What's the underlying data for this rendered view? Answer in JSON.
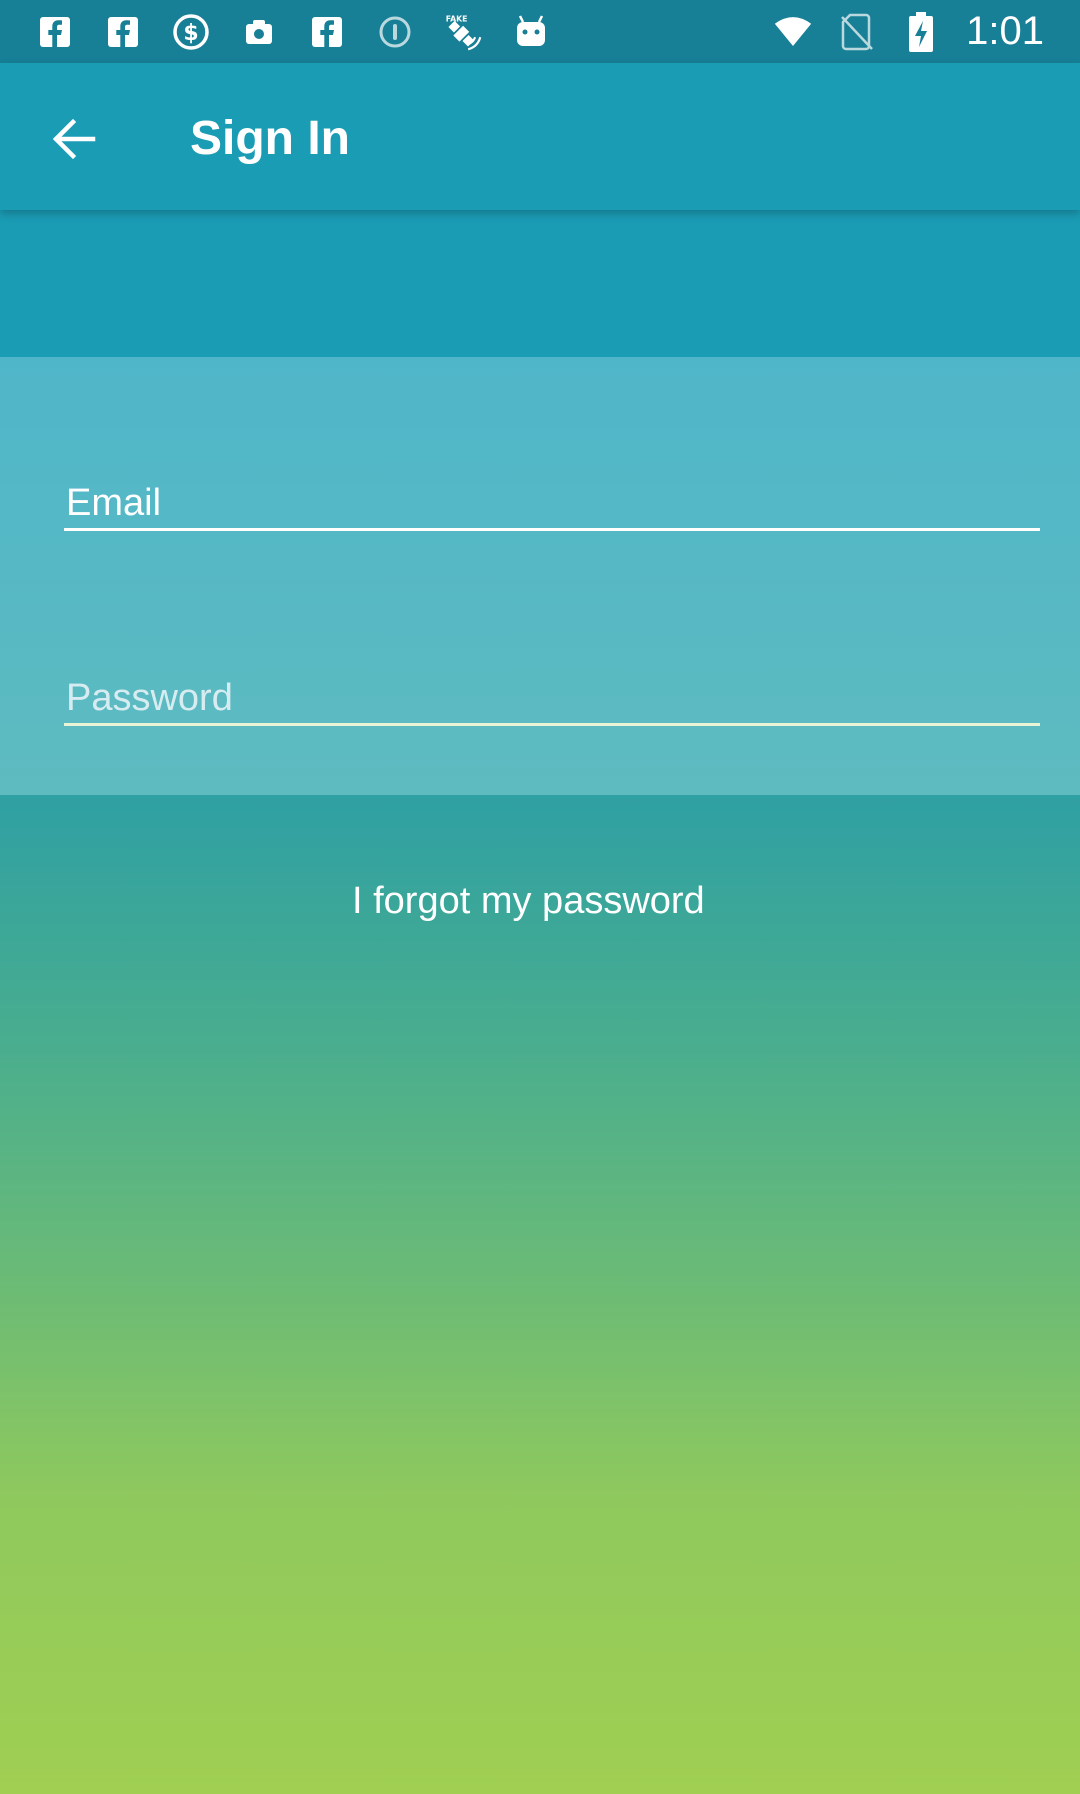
{
  "status_bar": {
    "time": "1:01",
    "left_icons": [
      "facebook-icon",
      "facebook-icon",
      "dollar-circle-icon",
      "camera-icon",
      "facebook-icon",
      "info-circle-icon",
      "fake-gps-satellite-icon",
      "android-robot-icon"
    ],
    "right_icons": [
      "wifi-icon",
      "no-sim-icon",
      "battery-charging-icon"
    ]
  },
  "toolbar": {
    "back_icon": "arrow-left-icon",
    "title": "Sign In"
  },
  "form": {
    "email_placeholder": "Email",
    "password_placeholder": "Password",
    "forgot_password_label": "I forgot my password"
  },
  "colors": {
    "status_bar_bg": "#177f96",
    "toolbar_bg": "#1b9cb5",
    "form_panel_bg": "#50b6c8",
    "gradient_bottom": "#a0cf52"
  }
}
